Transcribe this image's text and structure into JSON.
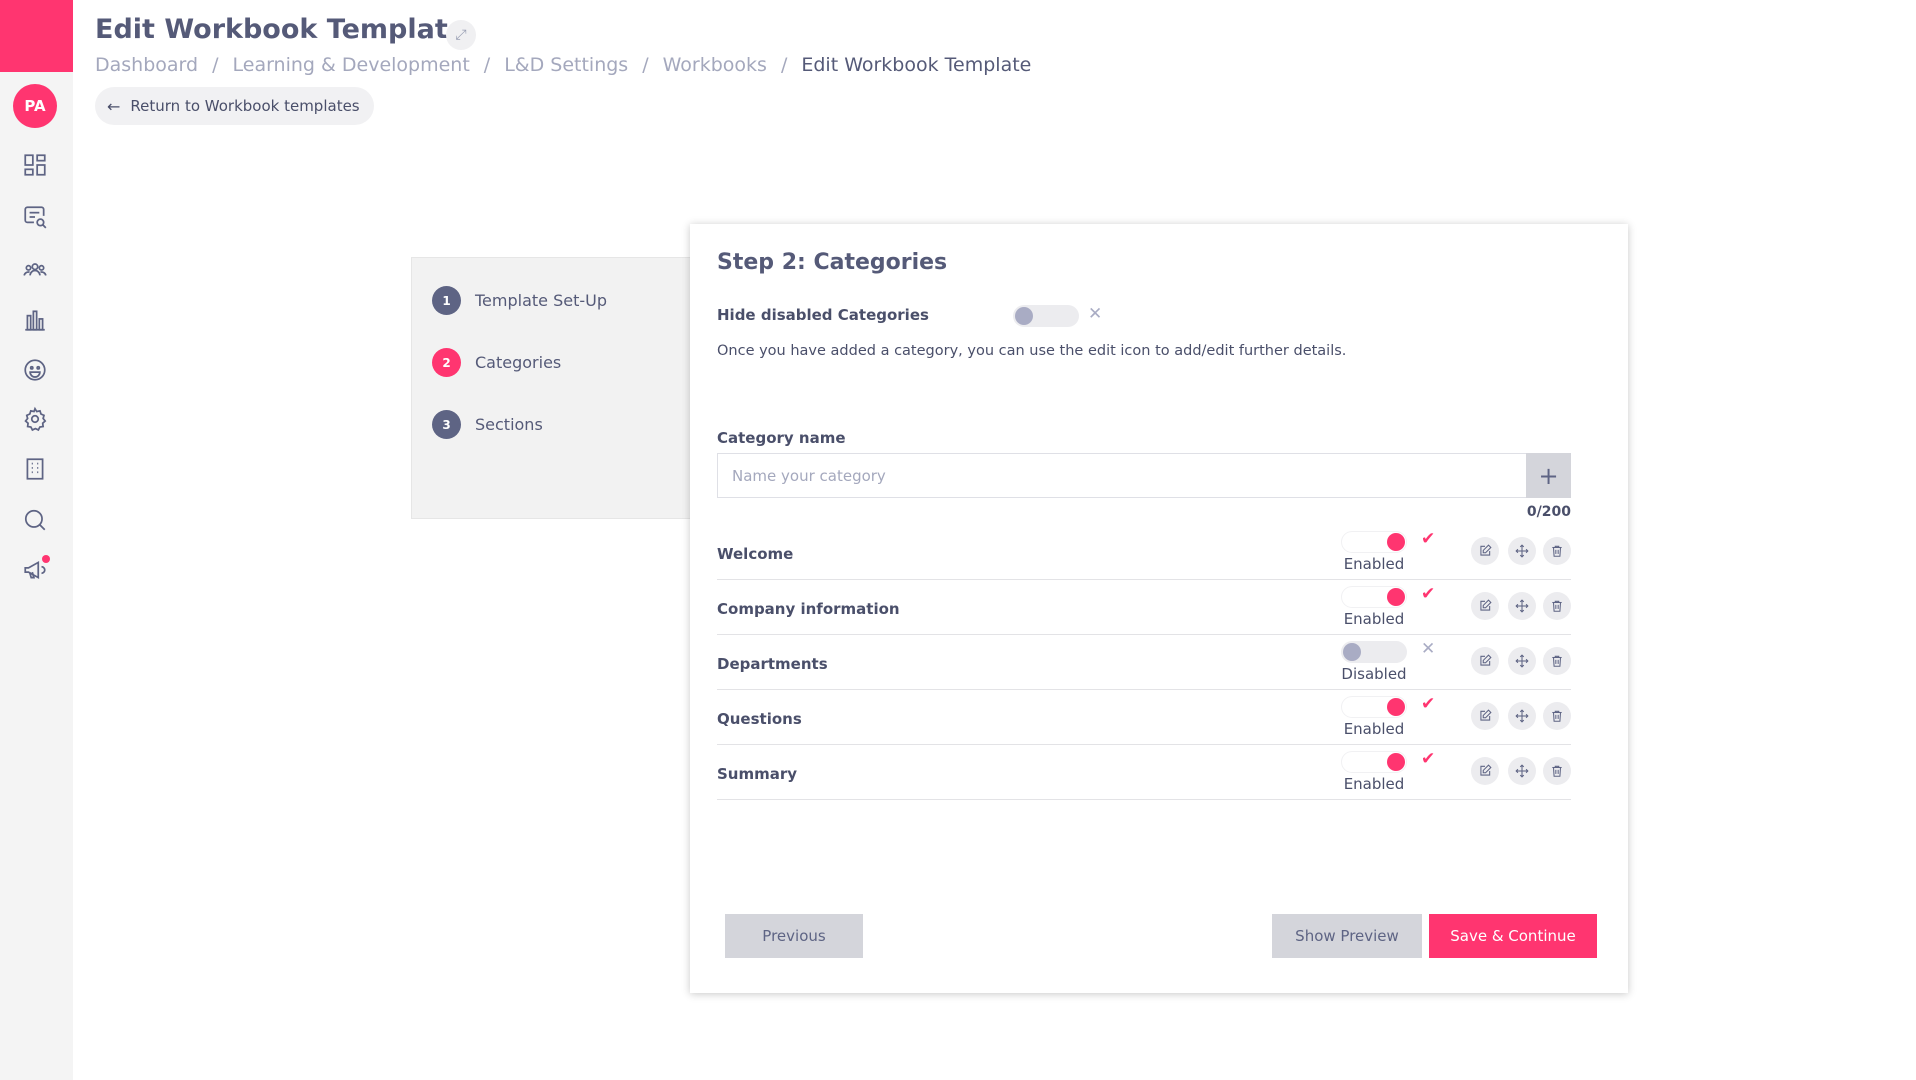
{
  "sidebar": {
    "avatar_initials": "PA",
    "icons": [
      "dashboard-icon",
      "search-document-icon",
      "people-icon",
      "bar-chart-icon",
      "smiley-icon",
      "gear-icon",
      "building-icon",
      "search-icon",
      "megaphone-icon"
    ]
  },
  "header": {
    "title": "Edit Workbook Template",
    "breadcrumb": [
      "Dashboard",
      "Learning & Development",
      "L&D Settings",
      "Workbooks",
      "Edit Workbook Template"
    ],
    "return_label": "Return to Workbook templates"
  },
  "steps": [
    {
      "number": "1",
      "label": "Template Set-Up",
      "active": false
    },
    {
      "number": "2",
      "label": "Categories",
      "active": true
    },
    {
      "number": "3",
      "label": "Sections",
      "active": false
    }
  ],
  "card": {
    "title": "Step 2: Categories",
    "hide_disabled_label": "Hide disabled Categories",
    "info_text": "Once you have added a category, you can use the edit icon to add/edit further details.",
    "category_name_label": "Category name",
    "category_placeholder": "Name your category",
    "category_value": "",
    "counter": "0/200",
    "categories": [
      {
        "name": "Welcome",
        "status": "Enabled",
        "enabled": true
      },
      {
        "name": "Company information",
        "status": "Enabled",
        "enabled": true
      },
      {
        "name": "Departments",
        "status": "Disabled",
        "enabled": false
      },
      {
        "name": "Questions",
        "status": "Enabled",
        "enabled": true
      },
      {
        "name": "Summary",
        "status": "Enabled",
        "enabled": true
      }
    ],
    "previous_label": "Previous",
    "preview_label": "Show Preview",
    "save_label": "Save & Continue"
  },
  "colors": {
    "accent": "#ff3570",
    "text": "#4a4f6a",
    "muted": "#a4a8bd",
    "button_grey": "#d4d5db"
  }
}
